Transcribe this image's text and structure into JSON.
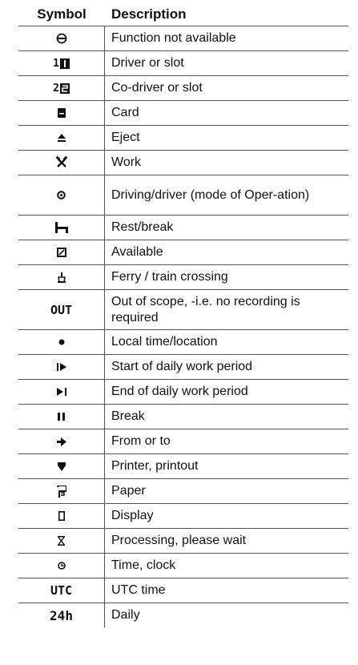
{
  "header": {
    "symbol": "Symbol",
    "description": "Description"
  },
  "rows": [
    {
      "icon": "minus-circle-icon",
      "text": "Function not available"
    },
    {
      "icon": "driver-slot-1-icon",
      "glyph": "1",
      "text": "Driver or slot"
    },
    {
      "icon": "codriver-slot-2-icon",
      "glyph": "2",
      "text": "Co-driver or slot"
    },
    {
      "icon": "card-icon",
      "text": "Card"
    },
    {
      "icon": "eject-icon",
      "text": "Eject"
    },
    {
      "icon": "work-hammers-icon",
      "text": "Work"
    },
    {
      "icon": "steering-wheel-icon",
      "text": "Driving/driver (mode of Oper-ation)"
    },
    {
      "icon": "bed-rest-icon",
      "text": "Rest/break"
    },
    {
      "icon": "available-icon",
      "text": "Available"
    },
    {
      "icon": "ferry-icon",
      "text": "Ferry / train crossing"
    },
    {
      "icon": "out-text-icon",
      "glyph": "OUT",
      "text": "Out of scope, -i.e. no recording is required"
    },
    {
      "icon": "dot-icon",
      "text": "Local time/location"
    },
    {
      "icon": "start-period-icon",
      "text": "Start of daily work period"
    },
    {
      "icon": "end-period-icon",
      "text": "End of daily work period"
    },
    {
      "icon": "pause-icon",
      "text": "Break"
    },
    {
      "icon": "arrow-right-icon",
      "text": "From or to"
    },
    {
      "icon": "printer-icon",
      "text": "Printer, printout"
    },
    {
      "icon": "paper-icon",
      "text": "Paper"
    },
    {
      "icon": "display-icon",
      "text": "Display"
    },
    {
      "icon": "hourglass-icon",
      "text": "Processing, please wait"
    },
    {
      "icon": "clock-icon",
      "text": "Time, clock"
    },
    {
      "icon": "utc-text-icon",
      "glyph": "UTC",
      "text": "UTC time"
    },
    {
      "icon": "24h-text-icon",
      "glyph": "24h",
      "text": "Daily"
    }
  ]
}
